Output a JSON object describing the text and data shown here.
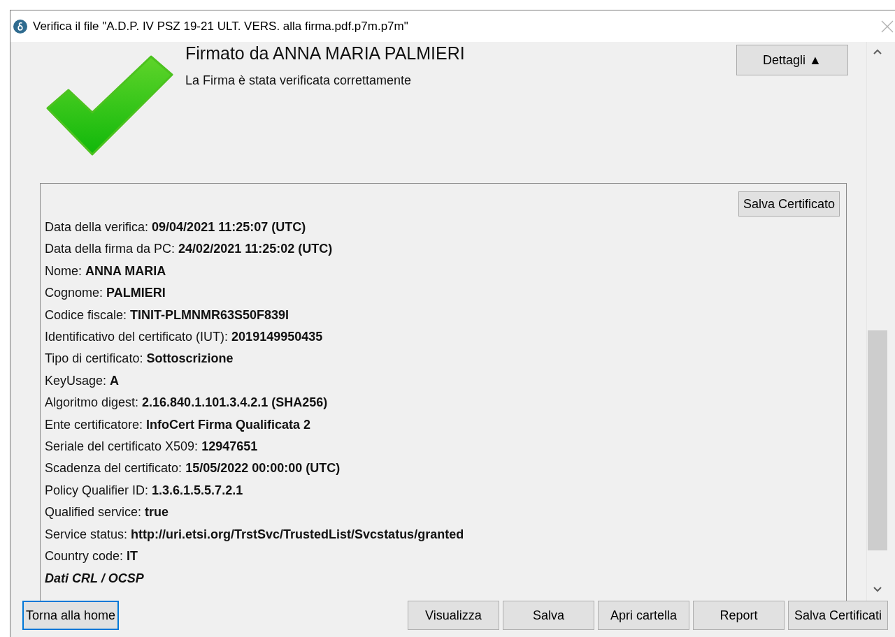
{
  "window": {
    "title": "Verifica il file \"A.D.P. IV PSZ 19-21 ULT. VERS. alla firma.pdf.p7m.p7m\""
  },
  "header": {
    "title": "Firmato da ANNA MARIA PALMIERI",
    "subtitle": "La Firma è stata verificata correttamente",
    "details_button": "Dettagli",
    "details_icon": "▲"
  },
  "details": {
    "save_button": "Salva Certificato",
    "fields": [
      {
        "kind": "field",
        "label": "Data della verifica:",
        "value": "09/04/2021 11:25:07 (UTC)"
      },
      {
        "kind": "field",
        "label": "Data della firma da PC:",
        "value": "24/02/2021 11:25:02 (UTC)"
      },
      {
        "kind": "field",
        "label": "Nome:",
        "value": "ANNA MARIA"
      },
      {
        "kind": "field",
        "label": "Cognome:",
        "value": "PALMIERI"
      },
      {
        "kind": "field",
        "label": "Codice fiscale:",
        "value": "TINIT-PLMNMR63S50F839I"
      },
      {
        "kind": "field",
        "label": "Identificativo del certificato (IUT):",
        "value": "2019149950435"
      },
      {
        "kind": "field",
        "label": "Tipo di certificato:",
        "value": "Sottoscrizione"
      },
      {
        "kind": "field",
        "label": "KeyUsage:",
        "value": "A"
      },
      {
        "kind": "field",
        "label": "Algoritmo digest:",
        "value": "2.16.840.1.101.3.4.2.1 (SHA256)"
      },
      {
        "kind": "field",
        "label": "Ente certificatore:",
        "value": "InfoCert Firma Qualificata 2"
      },
      {
        "kind": "field",
        "label": "Seriale del certificato X509:",
        "value": "12947651"
      },
      {
        "kind": "field",
        "label": "Scadenza del certificato:",
        "value": "15/05/2022 00:00:00 (UTC)"
      },
      {
        "kind": "field",
        "label": "Policy Qualifier ID:",
        "value": "1.3.6.1.5.5.7.2.1"
      },
      {
        "kind": "field",
        "label": "Qualified service:",
        "value": "true"
      },
      {
        "kind": "field",
        "label": "Service status:",
        "value": "http://uri.etsi.org/TrstSvc/TrustedList/Svcstatus/granted"
      },
      {
        "kind": "field",
        "label": "Country code:",
        "value": "IT"
      },
      {
        "kind": "heading",
        "value": "Dati CRL / OCSP"
      }
    ]
  },
  "footer": {
    "home_button": {
      "label": "Torna alla home",
      "selected": true
    },
    "buttons": [
      "Visualizza",
      "Salva",
      "Apri cartella",
      "Report",
      "Salva Certificati"
    ]
  }
}
